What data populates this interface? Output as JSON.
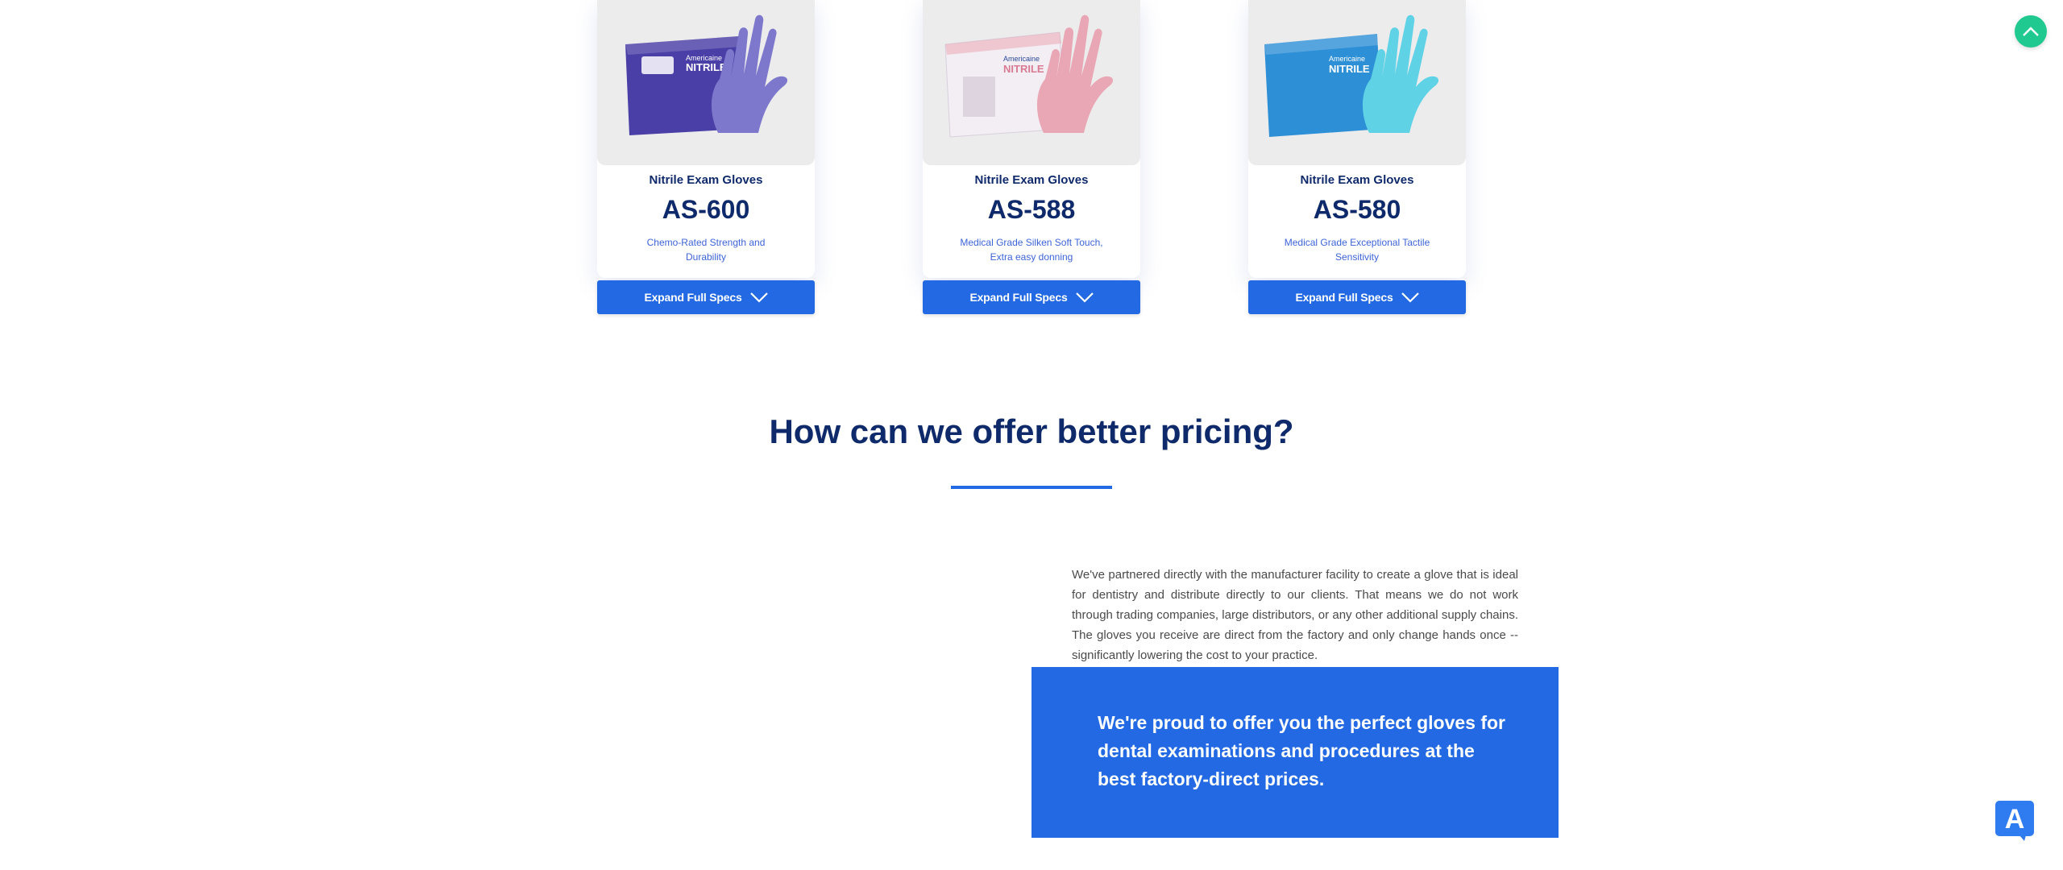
{
  "products": [
    {
      "category": "Nitrile Exam Gloves",
      "model": "AS-600",
      "description": "Chemo-Rated Strength and Durability",
      "button_label": "Expand Full Specs",
      "box_color": "#4a3fa6",
      "glove_color": "#7d78cc"
    },
    {
      "category": "Nitrile Exam Gloves",
      "model": "AS-588",
      "description": "Medical Grade Silken Soft Touch, Extra easy donning",
      "button_label": "Expand Full Specs",
      "box_color": "#f3eef4",
      "glove_color": "#e9a7b5"
    },
    {
      "category": "Nitrile Exam Gloves",
      "model": "AS-580",
      "description": "Medical Grade Exceptional Tactile Sensitivity",
      "button_label": "Expand Full Specs",
      "box_color": "#2d8fd6",
      "glove_color": "#5fd2e6"
    }
  ],
  "pricing": {
    "heading": "How can we offer better pricing?",
    "paragraph": "We've partnered directly with the manufacturer facility to create a glove that is ideal for dentistry and distribute directly to our clients. That means we do not work through trading companies, large distributors, or any other additional supply chains. The gloves you receive are direct from the factory and only change hands once -- significantly lowering the cost to your practice.",
    "callout": "We're proud to offer you the perfect gloves for dental examinations and procedures at the best factory-direct prices."
  },
  "box_labels": {
    "brand": "Americaine",
    "product": "NITRILE"
  },
  "accessibility_button": {
    "glyph": "A"
  },
  "colors": {
    "brand_blue": "#2269e3",
    "navy": "#0f2a6b",
    "scroll_top": "#1fc98f"
  },
  "icons": {
    "expand": "chevron-down-icon",
    "scroll_top": "chevron-up-icon",
    "accessibility": "accessibility-icon"
  }
}
